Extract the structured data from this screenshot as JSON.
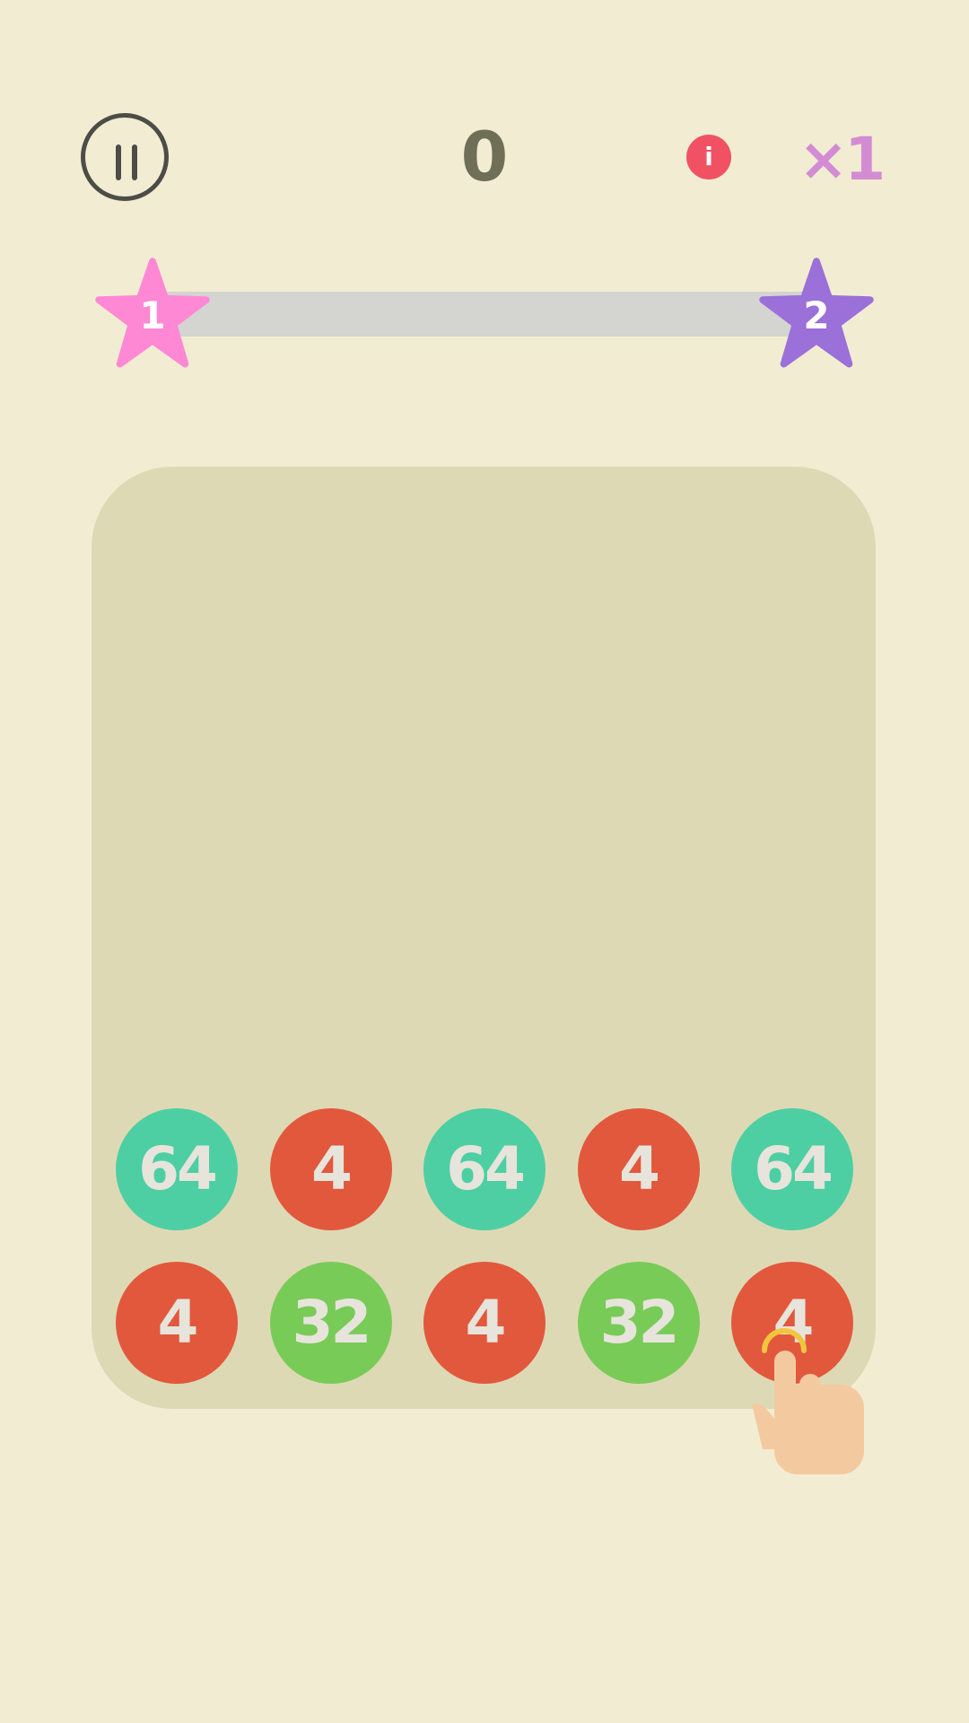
{
  "header": {
    "score": "0",
    "info_label": "i",
    "multiplier": "×1"
  },
  "progress": {
    "fraction": 0,
    "current_level": "1",
    "next_level": "2",
    "current_color": "#ff88d5",
    "next_color": "#9b70d8"
  },
  "board": {
    "rows": [
      [
        {
          "value": "64",
          "color": "teal"
        },
        {
          "value": "4",
          "color": "red"
        },
        {
          "value": "64",
          "color": "teal"
        },
        {
          "value": "4",
          "color": "red"
        },
        {
          "value": "64",
          "color": "teal"
        }
      ],
      [
        {
          "value": "4",
          "color": "red"
        },
        {
          "value": "32",
          "color": "green"
        },
        {
          "value": "4",
          "color": "red"
        },
        {
          "value": "32",
          "color": "green"
        },
        {
          "value": "4",
          "color": "red"
        }
      ]
    ]
  },
  "tutorial": {
    "icon": "pointing-hand-icon"
  }
}
